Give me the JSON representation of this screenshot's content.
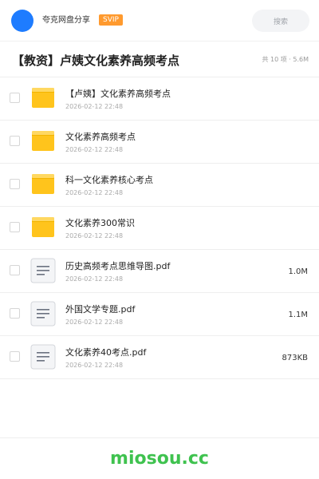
{
  "header": {
    "user_name": "夸克网盘分享",
    "badge": "SVIP",
    "search_placeholder": "搜索"
  },
  "share": {
    "title": "【教资】卢姨文化素养高频考点",
    "summary": "共 10 项 · 5.6M"
  },
  "items": [
    {
      "type": "folder",
      "name": "【卢姨】文化素养高频考点",
      "date": "2026-02-12 22:48",
      "size": ""
    },
    {
      "type": "folder",
      "name": "文化素养高频考点",
      "date": "2026-02-12 22:48",
      "size": ""
    },
    {
      "type": "folder",
      "name": "科一文化素养核心考点",
      "date": "2026-02-12 22:48",
      "size": ""
    },
    {
      "type": "folder",
      "name": "文化素养300常识",
      "date": "2026-02-12 22:48",
      "size": ""
    },
    {
      "type": "pdf",
      "name": "历史高频考点思维导图.pdf",
      "date": "2026-02-12 22:48",
      "size": "1.0M"
    },
    {
      "type": "pdf",
      "name": "外国文学专题.pdf",
      "date": "2026-02-12 22:48",
      "size": "1.1M"
    },
    {
      "type": "pdf",
      "name": "文化素养40考点.pdf",
      "date": "2026-02-12 22:48",
      "size": "873KB"
    }
  ],
  "footer": {
    "watermark": "miosou.cc"
  },
  "colors": {
    "accent": "#1e7cff",
    "svip": "#ff9a2e",
    "folder": "#ffc41c",
    "watermark": "#3fc24f"
  }
}
